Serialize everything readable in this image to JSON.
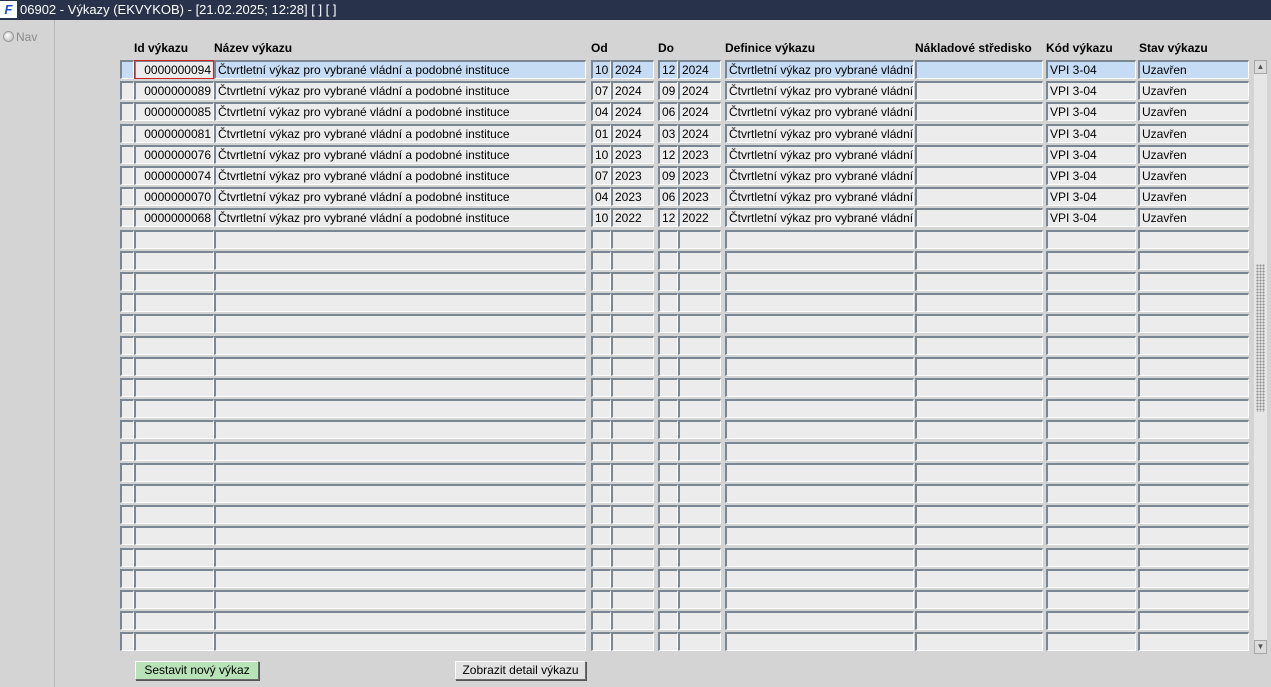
{
  "window": {
    "title": "06902 - Výkazy (EKVYKOB) - [21.02.2025; 12:28]  [ ]  [ ]",
    "app_icon": "ifs-logo-icon",
    "app_icon_glyph": "F"
  },
  "nav": {
    "label": "Nav"
  },
  "columns": {
    "id": "Id výkazu",
    "nazev": "Název výkazu",
    "od": "Od",
    "do": "Do",
    "definice": "Definice výkazu",
    "stredisko": "Nákladové středisko",
    "kod": "Kód výkazu",
    "stav": "Stav výkazu"
  },
  "rows": [
    {
      "id": "0000000094",
      "nazev": "Čtvrtletní výkaz pro vybrané vládní a podobné instituce",
      "od_m": "10",
      "od_y": "2024",
      "do_m": "12",
      "do_y": "2024",
      "definice": "Čtvrtletní výkaz pro vybrané vládní a",
      "stredisko": "",
      "kod": "VPI 3-04",
      "stav": "Uzavřen"
    },
    {
      "id": "0000000089",
      "nazev": "Čtvrtletní výkaz pro vybrané vládní a podobné instituce",
      "od_m": "07",
      "od_y": "2024",
      "do_m": "09",
      "do_y": "2024",
      "definice": "Čtvrtletní výkaz pro vybrané vládní a",
      "stredisko": "",
      "kod": "VPI 3-04",
      "stav": "Uzavřen"
    },
    {
      "id": "0000000085",
      "nazev": "Čtvrtletní výkaz pro vybrané vládní a podobné instituce",
      "od_m": "04",
      "od_y": "2024",
      "do_m": "06",
      "do_y": "2024",
      "definice": "Čtvrtletní výkaz pro vybrané vládní a",
      "stredisko": "",
      "kod": "VPI 3-04",
      "stav": "Uzavřen"
    },
    {
      "id": "0000000081",
      "nazev": "Čtvrtletní výkaz pro vybrané vládní a podobné instituce",
      "od_m": "01",
      "od_y": "2024",
      "do_m": "03",
      "do_y": "2024",
      "definice": "Čtvrtletní výkaz pro vybrané vládní a",
      "stredisko": "",
      "kod": "VPI 3-04",
      "stav": "Uzavřen"
    },
    {
      "id": "0000000076",
      "nazev": "Čtvrtletní výkaz pro vybrané vládní a podobné instituce",
      "od_m": "10",
      "od_y": "2023",
      "do_m": "12",
      "do_y": "2023",
      "definice": "Čtvrtletní výkaz pro vybrané vládní a",
      "stredisko": "",
      "kod": "VPI 3-04",
      "stav": "Uzavřen"
    },
    {
      "id": "0000000074",
      "nazev": "Čtvrtletní výkaz pro vybrané vládní a podobné instituce",
      "od_m": "07",
      "od_y": "2023",
      "do_m": "09",
      "do_y": "2023",
      "definice": "Čtvrtletní výkaz pro vybrané vládní a",
      "stredisko": "",
      "kod": "VPI 3-04",
      "stav": "Uzavřen"
    },
    {
      "id": "0000000070",
      "nazev": "Čtvrtletní výkaz pro vybrané vládní a podobné instituce",
      "od_m": "04",
      "od_y": "2023",
      "do_m": "06",
      "do_y": "2023",
      "definice": "Čtvrtletní výkaz pro vybrané vládní a",
      "stredisko": "",
      "kod": "VPI 3-04",
      "stav": "Uzavřen"
    },
    {
      "id": "0000000068",
      "nazev": "Čtvrtletní výkaz pro vybrané vládní a podobné instituce",
      "od_m": "10",
      "od_y": "2022",
      "do_m": "12",
      "do_y": "2022",
      "definice": "Čtvrtletní výkaz pro vybrané vládní a",
      "stredisko": "",
      "kod": "VPI 3-04",
      "stav": "Uzavřen"
    }
  ],
  "empty_row_count": 20,
  "selected_row": 0,
  "scrollbar": {
    "up_icon": "scroll-up-arrow-icon",
    "down_icon": "scroll-down-arrow-icon"
  },
  "buttons": {
    "new_report": "Sestavit nový výkaz",
    "show_detail": "Zobrazit detail výkazu"
  },
  "colors": {
    "titlebar": "#28324a",
    "selected_row": "#c6dcf4",
    "new_report_button": "#b8e2b8",
    "focus_border": "#cc2222"
  }
}
